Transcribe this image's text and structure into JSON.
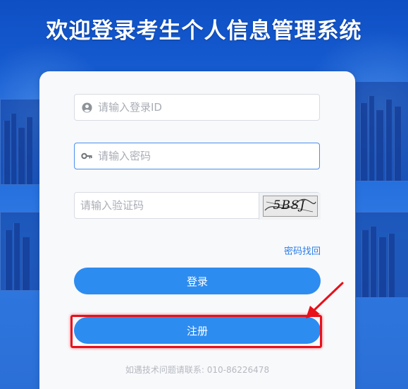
{
  "page": {
    "title": "欢迎登录考生个人信息管理系统"
  },
  "form": {
    "login_id": {
      "placeholder": "请输入登录ID",
      "value": "",
      "icon": "user-icon"
    },
    "password": {
      "placeholder": "请输入密码",
      "value": "",
      "icon": "key-icon"
    },
    "captcha": {
      "placeholder": "请输入验证码",
      "value": "",
      "image_text": "5BSJ"
    },
    "forgot_link": "密码找回",
    "login_button": "登录",
    "register_button": "注册"
  },
  "footer": {
    "support_text": "如遇技术问题请联系: 010-86226478"
  },
  "colors": {
    "primary": "#2d8cf0",
    "link": "#2b7de9",
    "annotation": "#e8101a",
    "background": "#1a63d8"
  }
}
